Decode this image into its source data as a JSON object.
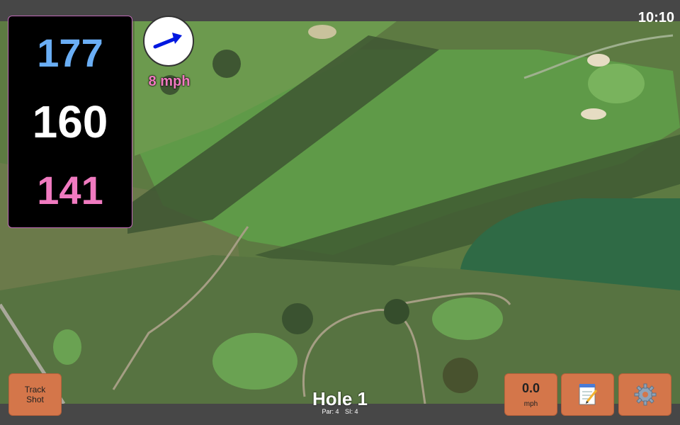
{
  "status": {
    "time": "10:10"
  },
  "distances": {
    "back": "177",
    "middle": "160",
    "front": "141"
  },
  "wind": {
    "speed": "8 mph",
    "icon": "wind-direction-arrow-icon"
  },
  "buttons": {
    "track_line1": "Track",
    "track_line2": "Shot",
    "speed_value": "0.0",
    "speed_unit": "mph",
    "notes_icon": "notepad-icon",
    "settings_icon": "gear-icon"
  },
  "hole": {
    "title": "Hole 1",
    "par": "Par: 4",
    "si": "SI: 4"
  },
  "colors": {
    "back_distance": "#6aaef5",
    "middle_distance": "#ffffff",
    "front_distance": "#f07ac0",
    "button_bg": "#d4764a",
    "panel_border": "#c06ab9"
  }
}
